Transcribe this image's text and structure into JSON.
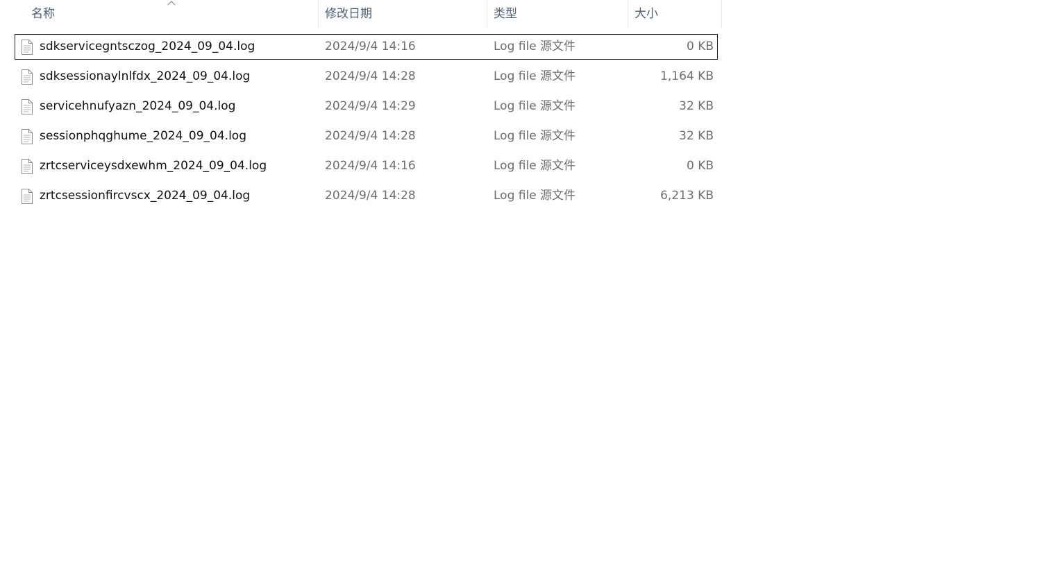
{
  "columns": {
    "name": "名称",
    "date": "修改日期",
    "type": "类型",
    "size": "大小"
  },
  "sort": {
    "column": "name",
    "direction": "ascending",
    "icon": "chevron-up-icon"
  },
  "files": [
    {
      "name": "sdkservicegntsczog_2024_09_04.log",
      "date": "2024/9/4 14:16",
      "type": "Log file 源文件",
      "size": "0 KB",
      "icon": "file-icon",
      "focused": true
    },
    {
      "name": "sdksessionaylnlfdx_2024_09_04.log",
      "date": "2024/9/4 14:28",
      "type": "Log file 源文件",
      "size": "1,164 KB",
      "icon": "file-icon"
    },
    {
      "name": "servicehnufyazn_2024_09_04.log",
      "date": "2024/9/4 14:29",
      "type": "Log file 源文件",
      "size": "32 KB",
      "icon": "file-icon"
    },
    {
      "name": "sessionphqghume_2024_09_04.log",
      "date": "2024/9/4 14:28",
      "type": "Log file 源文件",
      "size": "32 KB",
      "icon": "file-icon"
    },
    {
      "name": "zrtcserviceysdxewhm_2024_09_04.log",
      "date": "2024/9/4 14:16",
      "type": "Log file 源文件",
      "size": "0 KB",
      "icon": "file-icon"
    },
    {
      "name": "zrtcsessionfircvscx_2024_09_04.log",
      "date": "2024/9/4 14:28",
      "type": "Log file 源文件",
      "size": "6,213 KB",
      "icon": "file-icon"
    }
  ]
}
